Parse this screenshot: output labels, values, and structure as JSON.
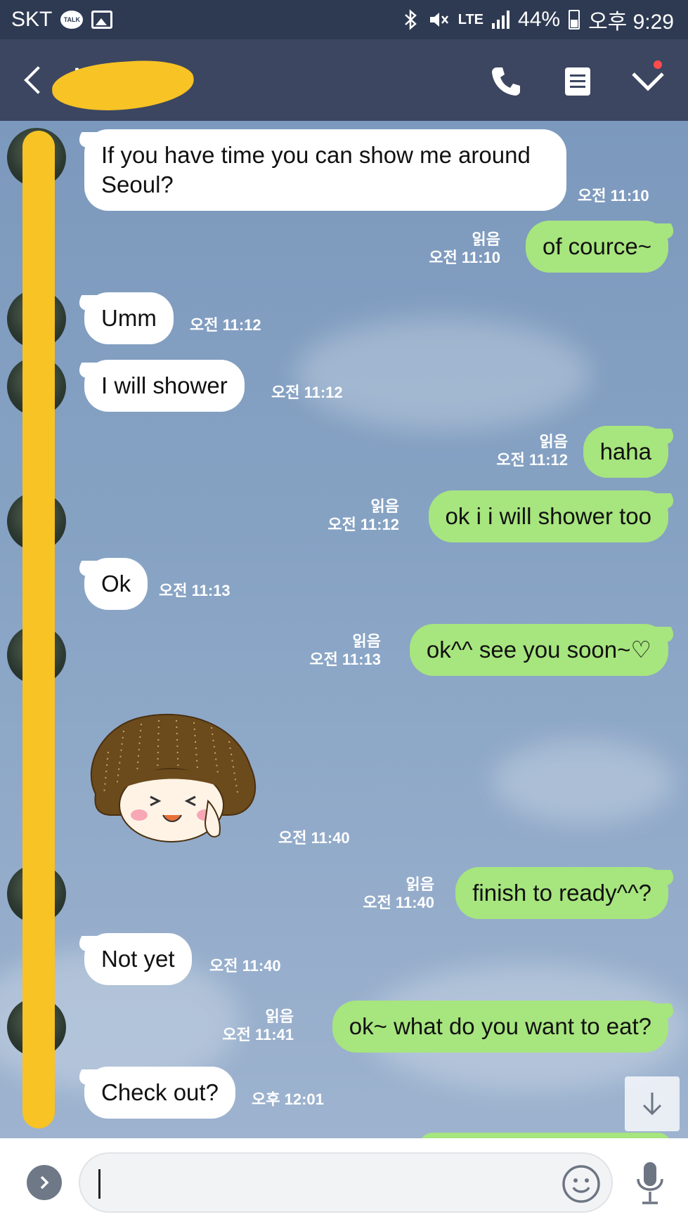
{
  "status_bar": {
    "carrier": "SKT",
    "talk_icon_text": "TALK",
    "network": "LTE",
    "battery": "44%",
    "time": "오후 9:29",
    "icons": [
      "talk-icon",
      "image-icon",
      "bluetooth-icon",
      "mute-icon",
      "signal-icon",
      "battery-icon"
    ]
  },
  "header": {
    "title": "N",
    "icons": [
      "back-icon",
      "phone-icon",
      "menu-icon",
      "chevron-down-icon"
    ]
  },
  "messages": [
    {
      "dir": "in",
      "text": "If you have time you can show me around Seoul?",
      "time": "오전 11:10"
    },
    {
      "dir": "out",
      "text": "of cource~",
      "read": "읽음",
      "time": "오전 11:10"
    },
    {
      "dir": "in",
      "text": "Umm",
      "time": "오전 11:12"
    },
    {
      "dir": "in",
      "text": "I will shower",
      "time": "오전 11:12"
    },
    {
      "dir": "out",
      "text": "haha",
      "read": "읽음",
      "time": "오전 11:12"
    },
    {
      "dir": "out",
      "text": "ok i i will shower too",
      "read": "읽음",
      "time": "오전 11:12"
    },
    {
      "dir": "in",
      "text": "Ok",
      "time": "오전 11:13"
    },
    {
      "dir": "out",
      "text": "ok^^ see you soon~♡",
      "read": "읽음",
      "time": "오전 11:13"
    },
    {
      "dir": "in",
      "type": "sticker",
      "sticker": "girl-sticker",
      "time": "오전 11:40"
    },
    {
      "dir": "out",
      "text": "finish to ready^^?",
      "read": "읽음",
      "time": "오전 11:40"
    },
    {
      "dir": "in",
      "text": "Not yet",
      "time": "오전 11:40"
    },
    {
      "dir": "out",
      "text": "ok~ what do you want to eat?",
      "read": "읽음",
      "time": "오전 11:41"
    },
    {
      "dir": "in",
      "text": "Check out?",
      "time": "오후 12:01"
    }
  ],
  "input": {
    "value": "",
    "placeholder": ""
  },
  "colors": {
    "status_bar": "#2e3a52",
    "header": "#3c4661",
    "chat_bg": "#7f9cc0",
    "bubble_out": "#a7e57e",
    "bubble_in": "#ffffff",
    "redaction": "#f7c325"
  }
}
